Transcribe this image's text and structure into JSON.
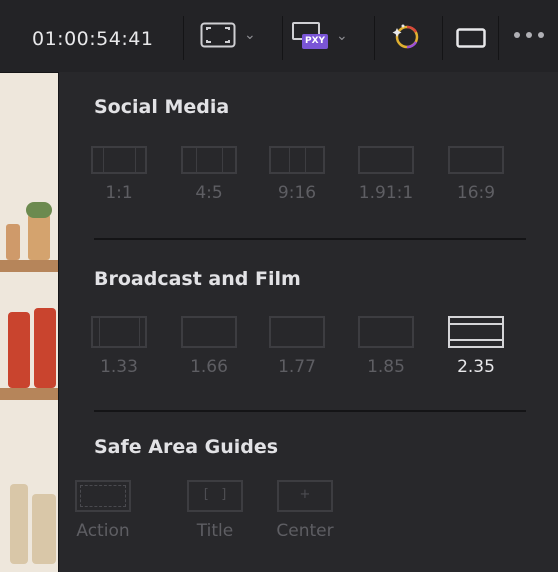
{
  "toolbar": {
    "timecode": "01:00:54:41",
    "proxy_badge": "PXY"
  },
  "sections": {
    "social": {
      "title": "Social Media",
      "options": [
        "1:1",
        "4:5",
        "9:16",
        "1.91:1",
        "16:9"
      ]
    },
    "broadcast": {
      "title": "Broadcast and Film",
      "options": [
        "1.33",
        "1.66",
        "1.77",
        "1.85",
        "2.35"
      ],
      "selected": "2.35"
    },
    "safe": {
      "title": "Safe Area Guides",
      "options": [
        "Action",
        "Title",
        "Center"
      ]
    }
  },
  "colors": {
    "background": "#28282b",
    "selected_text": "#e8e8eb",
    "muted_text": "#5e5e63",
    "proxy_badge": "#7a55d6"
  }
}
